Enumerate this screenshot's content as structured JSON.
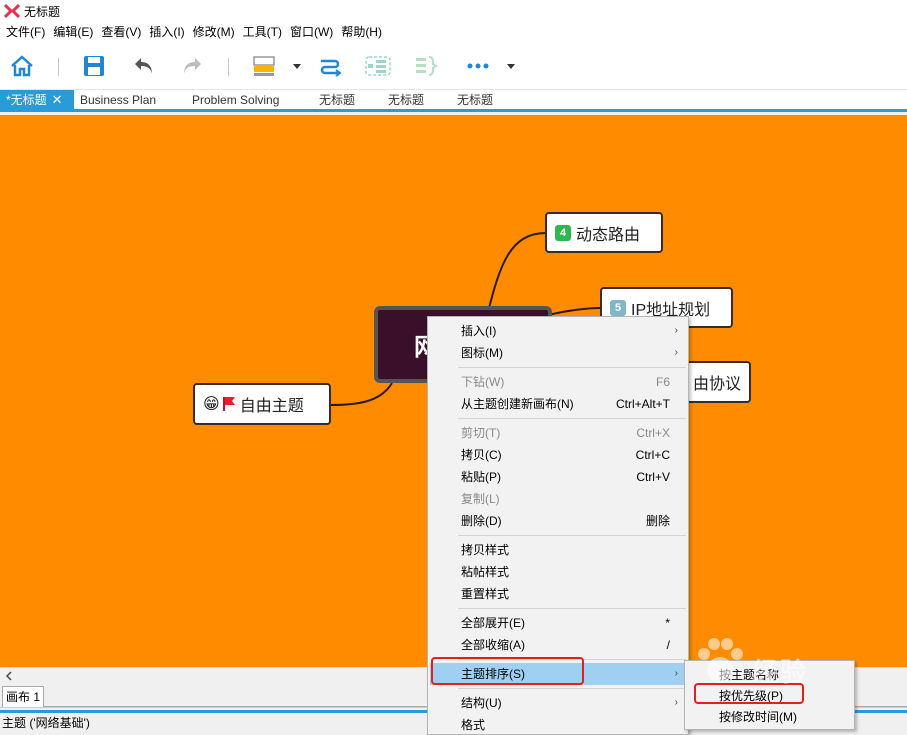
{
  "window": {
    "title": "无标题"
  },
  "menubar": {
    "items": [
      "文件(F)",
      "编辑(E)",
      "查看(V)",
      "插入(I)",
      "修改(M)",
      "工具(T)",
      "窗口(W)",
      "帮助(H)"
    ]
  },
  "toolbar": {
    "icons": [
      "home-icon",
      "save-icon",
      "undo-icon",
      "redo-icon",
      "topic-style-icon",
      "relationship-icon",
      "boundary-icon",
      "summary-icon",
      "more-icon"
    ]
  },
  "tabs": [
    {
      "label": "*无标题",
      "active": true
    },
    {
      "label": "Business Plan"
    },
    {
      "label": "Problem Solving"
    },
    {
      "label": "无标题"
    },
    {
      "label": "无标题"
    },
    {
      "label": "无标题"
    }
  ],
  "canvas": {
    "background": "#ff8c00",
    "central_topic": "网",
    "topics": [
      {
        "badge": "4",
        "badge_color": "#2db84d",
        "label": "动态路由"
      },
      {
        "badge": "5",
        "badge_color": "#7fb7c9",
        "label": "IP地址规划"
      },
      {
        "label": "由协议"
      },
      {
        "emoji": "😁",
        "flag": "red-flag-icon",
        "label": "自由主题"
      }
    ]
  },
  "sheet": {
    "tab_label": "画布 1"
  },
  "status": {
    "text": "主题 ('网络基础')"
  },
  "context_menu": {
    "items": [
      {
        "label": "插入(I)",
        "submenu": true
      },
      {
        "label": "图标(M)",
        "submenu": true
      },
      {
        "label": "下钻(W)",
        "shortcut": "F6",
        "disabled": true
      },
      {
        "label": "从主题创建新画布(N)",
        "shortcut": "Ctrl+Alt+T"
      },
      {
        "label": "剪切(T)",
        "shortcut": "Ctrl+X",
        "disabled": true
      },
      {
        "label": "拷贝(C)",
        "shortcut": "Ctrl+C"
      },
      {
        "label": "粘贴(P)",
        "shortcut": "Ctrl+V"
      },
      {
        "label": "复制(L)",
        "disabled": true
      },
      {
        "label": "删除(D)",
        "shortcut": "删除"
      },
      {
        "label": "拷贝样式"
      },
      {
        "label": "粘帖样式"
      },
      {
        "label": "重置样式"
      },
      {
        "label": "全部展开(E)",
        "shortcut": "*"
      },
      {
        "label": "全部收缩(A)",
        "shortcut": "/"
      },
      {
        "label": "主题排序(S)",
        "submenu": true,
        "highlight": true
      },
      {
        "label": "结构(U)",
        "submenu": true
      },
      {
        "label": "格式"
      }
    ]
  },
  "sort_submenu": {
    "items": [
      {
        "label": "按主题名称"
      },
      {
        "label": "按优先级(P)"
      },
      {
        "label": "按修改时间(M)"
      }
    ]
  },
  "watermark": {
    "text": "经验"
  },
  "colors": {
    "accent": "#2b9bd8",
    "highlight_outline": "#e0231a",
    "menu_highlight": "#9fd0f2"
  }
}
